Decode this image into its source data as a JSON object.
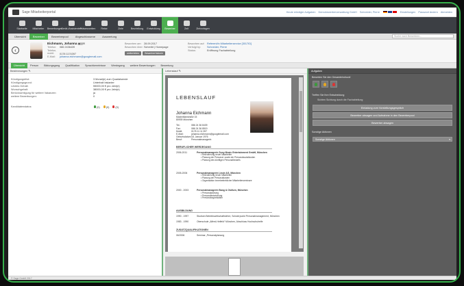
{
  "app": {
    "title": "Sage Mitarbeiterportal"
  },
  "toplinks": [
    "Heute erledigte Aufgaben",
    "Demobewerberverwaltung GmbH",
    "Schneider, Pierre",
    "Einstellungen",
    "Passwort ändern",
    "Abmelden"
  ],
  "nav": [
    {
      "label": "Startseite",
      "icon": "home-icon"
    },
    {
      "label": "Mitarbeiter",
      "icon": "person-icon"
    },
    {
      "label": "Bewerbungen",
      "icon": "people-icon"
    },
    {
      "label": "Gerät-/Assistenten",
      "icon": "devices-icon"
    },
    {
      "label": "Präsenzzeiten",
      "icon": "clock-icon"
    },
    {
      "label": "Reise",
      "icon": "plane-icon"
    },
    {
      "label": "Ziele",
      "icon": "target-icon"
    },
    {
      "label": "Beurteilung",
      "icon": "chart-icon"
    },
    {
      "label": "Entwicklung",
      "icon": "growth-icon"
    },
    {
      "label": "Bewerber",
      "icon": "applicant-icon",
      "active": true
    },
    {
      "label": "Zeit",
      "icon": "time-icon"
    },
    {
      "label": "Zielvorlagen",
      "icon": "template-icon"
    }
  ],
  "tabs1": [
    "Übersicht",
    "Bewerber",
    "Bewerberpool",
    "Abgeschlossene",
    "Auswertung"
  ],
  "tabs1_active": 1,
  "search1": {
    "placeholder": "Suche nach Bewerbern..."
  },
  "candidate": {
    "name": "Eichmann, Johanna",
    "phone": "086 2436439",
    "mobile": "0178 1174397",
    "email": "johanna.eichmann@googlemail.com",
    "applied_label": "Beworben am:",
    "applied_value": "28.09.2017",
    "via_label": "Beworben über:",
    "via_value": "Schreibt | Homepage",
    "position_label": "Beworben auf:",
    "position_value": "Referent/in Mitarbeiterservice [3017ID]",
    "assigned_label": "Verfolgt by:",
    "assigned_value": "Schneider, Pierre",
    "status_label": "Status:",
    "status_value": "Eröffnung Fachabteilung",
    "k_phone": "Telefon:",
    "k_mobile": "Telefon, mobil:",
    "k_email": "E-Mail:",
    "btn_forward": "weiterleiten",
    "btn_history": "Bewerberhistorie"
  },
  "tabs2": [
    "Übersicht",
    "Person",
    "Bildungsgang",
    "Qualifikation",
    "Sprachkenntnisse",
    "Werdegang",
    "weitere Bewerbungen",
    "Bewertung"
  ],
  "tabs2_active": 0,
  "left": {
    "title": "Bestimmungen",
    "rows": [
      {
        "k": "Kündigungsfrist:",
        "v": "3 Monat(e) zum Quartalsende"
      },
      {
        "k": "Kündigungsgrund:",
        "v": "Unterhalt bislanter"
      },
      {
        "k": "Letztes Gehalt:",
        "v": "55000,00 € pro Jahr(e)"
      },
      {
        "k": "Wunschgehalt:",
        "v": "38000,00 € pro Jahr(e)"
      },
      {
        "k": "Berücksichtigung für weitere Vakanzen:",
        "v": "ja"
      },
      {
        "k": "weitere Bewerbungen:",
        "v": "0"
      }
    ],
    "rating_label": "Kandidatenstatus:",
    "rating_counts": [
      "(0)",
      "(0)",
      "(0)"
    ]
  },
  "center": {
    "title": "Lebenslauf"
  },
  "cv": {
    "heading": "LEBENSLAUF",
    "name": "Johanna Eichmann",
    "address": [
      "Maximilianstraße 15",
      "80939 München"
    ],
    "contact": [
      {
        "k": "Tel.:",
        "v": "086 24 36 8439"
      },
      {
        "k": "Fax:",
        "v": "086 24 36 8519"
      },
      {
        "k": "Mobil:",
        "v": "0178 11 11 397"
      },
      {
        "k": "E-Mail:",
        "v": "johanna.eichmann@googlemail.com"
      },
      {
        "k": "Geburtsdatum:",
        "v": "18. Januar 1976"
      },
      {
        "k": "Beruf:",
        "v": "Personalmanagerin"
      }
    ],
    "sec_work": "BERUFLICHER WERDEGANG",
    "jobs": [
      {
        "d": "2006-2011",
        "t": "Personalmanagerin Sony Music Entertainment GmbH, München",
        "b": [
          "Rekrutierung neuer Mitarbeiter",
          "Planung der Personal- sowie der Personalsozialkosten",
          "Planung des künftigen Personalbedarfs"
        ]
      },
      {
        "d": "2005-2006",
        "t": "Personalmanagerin Linde AG, München",
        "b": [
          "Rekrutierung neuer Mitarbeiter",
          "Planung der Personalkosten",
          "Organisation innerbetrieblicher Mitarbeiterseminare"
        ]
      },
      {
        "d": "2000 - 2003",
        "t": "Personalmanagerin Bang & Olufsen, München",
        "b": [
          "Personalplanung",
          "Personalentwicklung",
          "Personalorganisation"
        ]
      }
    ],
    "sec_edu": "AUSBILDUNG",
    "edu": [
      {
        "d": "1990 - 1997",
        "t": "Studium Betriebswirtschaftslehre, Schwerpunkt Personalmanagement, München"
      },
      {
        "d": "1983 - 1990",
        "t": "Oberschule „Alfred-Helfeld“ München, Abschluss Hochschulreife"
      }
    ],
    "sec_extra": "ZUSATZQUALIFIKATIONEN",
    "extra": [
      {
        "d": "06/2006",
        "t": "Seminar „Personalplanung"
      }
    ]
  },
  "right": {
    "title": "Aufgaben",
    "rating_label": "Bewerten Sie den Gesamteindruck!",
    "decision_label": "Treffen Sie Ihre Entscheidung",
    "decision_sub": "Sichten Sichtung durch die Fachabteilung",
    "buttons": [
      "Einladung zum Vorstellungsgespräch",
      "Bewerber absagen und Aufnahme in den Bewerberpool",
      "Bewerber absagen"
    ],
    "sonst_label": "Sonstige Aktionen",
    "sonst_select": "Sonstige Aktionen"
  },
  "footer": "© Sage GmbH 2017",
  "colors": {
    "accent": "#4caf50",
    "nav": "#3c3f44",
    "panel": "#5c5c5c"
  }
}
